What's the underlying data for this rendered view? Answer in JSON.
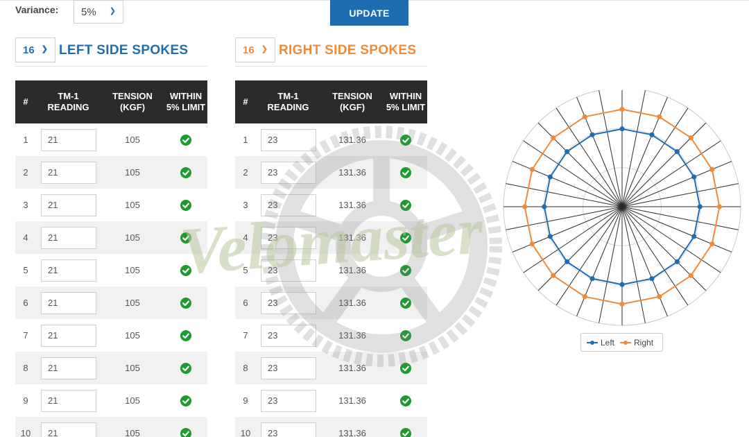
{
  "variance": {
    "label": "Variance:",
    "selected": "5%"
  },
  "update_button": {
    "label": "UPDATE"
  },
  "left": {
    "spoke_count": "16",
    "title": "LEFT SIDE SPOKES",
    "headers": [
      "#",
      "TM-1 READING",
      "TENSION (KGF)",
      "WITHIN 5% LIMIT"
    ],
    "rows": [
      {
        "num": "1",
        "reading": "21",
        "tension": "105",
        "within": true
      },
      {
        "num": "2",
        "reading": "21",
        "tension": "105",
        "within": true
      },
      {
        "num": "3",
        "reading": "21",
        "tension": "105",
        "within": true
      },
      {
        "num": "4",
        "reading": "21",
        "tension": "105",
        "within": true
      },
      {
        "num": "5",
        "reading": "21",
        "tension": "105",
        "within": true
      },
      {
        "num": "6",
        "reading": "21",
        "tension": "105",
        "within": true
      },
      {
        "num": "7",
        "reading": "21",
        "tension": "105",
        "within": true
      },
      {
        "num": "8",
        "reading": "21",
        "tension": "105",
        "within": true
      },
      {
        "num": "9",
        "reading": "21",
        "tension": "105",
        "within": true
      },
      {
        "num": "10",
        "reading": "21",
        "tension": "105",
        "within": true
      }
    ]
  },
  "right": {
    "spoke_count": "16",
    "title": "RIGHT SIDE SPOKES",
    "headers": [
      "#",
      "TM-1 READING",
      "TENSION (KGF)",
      "WITHIN 5% LIMIT"
    ],
    "rows": [
      {
        "num": "1",
        "reading": "23",
        "tension": "131.36",
        "within": true
      },
      {
        "num": "2",
        "reading": "23",
        "tension": "131.36",
        "within": true
      },
      {
        "num": "3",
        "reading": "23",
        "tension": "131.36",
        "within": true
      },
      {
        "num": "4",
        "reading": "23",
        "tension": "131.36",
        "within": true
      },
      {
        "num": "5",
        "reading": "23",
        "tension": "131.36",
        "within": true
      },
      {
        "num": "6",
        "reading": "23",
        "tension": "131.36",
        "within": true
      },
      {
        "num": "7",
        "reading": "23",
        "tension": "131.36",
        "within": true
      },
      {
        "num": "8",
        "reading": "23",
        "tension": "131.36",
        "within": true
      },
      {
        "num": "9",
        "reading": "23",
        "tension": "131.36",
        "within": true
      },
      {
        "num": "10",
        "reading": "23",
        "tension": "131.36",
        "within": true
      }
    ]
  },
  "watermark": {
    "text": "Velomaster"
  },
  "colors": {
    "left": "#1f6db1",
    "right": "#f08a3a",
    "ok": "#1e9a2f",
    "header_bg": "#2b2b2b"
  },
  "radar": {
    "legend": [
      {
        "name": "Left",
        "color": "#1f6db1"
      },
      {
        "name": "Right",
        "color": "#f08a3a"
      }
    ],
    "spokes": 16,
    "left_values": [
      105,
      105,
      105,
      105,
      105,
      105,
      105,
      105,
      105,
      105,
      105,
      105,
      105,
      105,
      105,
      105
    ],
    "right_values": [
      131.36,
      131.36,
      131.36,
      131.36,
      131.36,
      131.36,
      131.36,
      131.36,
      131.36,
      131.36,
      131.36,
      131.36,
      131.36,
      131.36,
      131.36,
      131.36
    ],
    "max": 160
  }
}
